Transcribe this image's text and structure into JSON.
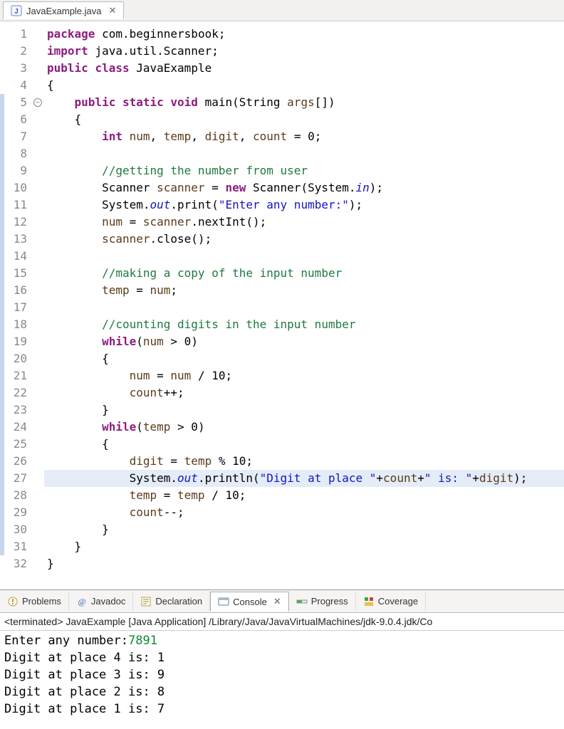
{
  "tab": {
    "filename": "JavaExample.java"
  },
  "gutter": {
    "lines": 32,
    "fold_at": 5
  },
  "highlight_line": 27,
  "blue_strip_ranges": [
    [
      5,
      31
    ]
  ],
  "code": {
    "l1": [
      [
        "kw",
        "package"
      ],
      [
        "punct",
        " "
      ],
      [
        "pkg",
        "com.beginnersbook"
      ],
      [
        "punct",
        ";"
      ]
    ],
    "l2": [
      [
        "kw",
        "import"
      ],
      [
        "punct",
        " "
      ],
      [
        "pkg",
        "java.util.Scanner"
      ],
      [
        "punct",
        ";"
      ]
    ],
    "l3": [
      [
        "kw",
        "public"
      ],
      [
        "punct",
        " "
      ],
      [
        "kw",
        "class"
      ],
      [
        "punct",
        " "
      ],
      [
        "cls",
        "JavaExample"
      ]
    ],
    "l4": [
      [
        "punct",
        "{"
      ]
    ],
    "l5": [
      [
        "punct",
        "    "
      ],
      [
        "kw",
        "public"
      ],
      [
        "punct",
        " "
      ],
      [
        "kw",
        "static"
      ],
      [
        "punct",
        " "
      ],
      [
        "kw",
        "void"
      ],
      [
        "punct",
        " "
      ],
      [
        "mname",
        "main"
      ],
      [
        "punct",
        "(String "
      ],
      [
        "var",
        "args"
      ],
      [
        "punct",
        "[])"
      ]
    ],
    "l6": [
      [
        "punct",
        "    {"
      ]
    ],
    "l7": [
      [
        "punct",
        "        "
      ],
      [
        "kw",
        "int"
      ],
      [
        "punct",
        " "
      ],
      [
        "var",
        "num"
      ],
      [
        "punct",
        ", "
      ],
      [
        "var",
        "temp"
      ],
      [
        "punct",
        ", "
      ],
      [
        "var",
        "digit"
      ],
      [
        "punct",
        ", "
      ],
      [
        "var",
        "count"
      ],
      [
        "punct",
        " = "
      ],
      [
        "num",
        "0"
      ],
      [
        "punct",
        ";"
      ]
    ],
    "l8": [
      [
        "punct",
        ""
      ]
    ],
    "l9": [
      [
        "punct",
        "        "
      ],
      [
        "cmt",
        "//getting the number from user"
      ]
    ],
    "l10": [
      [
        "punct",
        "        Scanner "
      ],
      [
        "var",
        "scanner"
      ],
      [
        "punct",
        " = "
      ],
      [
        "kw",
        "new"
      ],
      [
        "punct",
        " Scanner(System."
      ],
      [
        "stat",
        "in"
      ],
      [
        "punct",
        ");"
      ]
    ],
    "l11": [
      [
        "punct",
        "        System."
      ],
      [
        "stat",
        "out"
      ],
      [
        "punct",
        ".print("
      ],
      [
        "str",
        "\"Enter any number:\""
      ],
      [
        "punct",
        ");"
      ]
    ],
    "l12": [
      [
        "punct",
        "        "
      ],
      [
        "var",
        "num"
      ],
      [
        "punct",
        " = "
      ],
      [
        "var",
        "scanner"
      ],
      [
        "punct",
        ".nextInt();"
      ]
    ],
    "l13": [
      [
        "punct",
        "        "
      ],
      [
        "var",
        "scanner"
      ],
      [
        "punct",
        ".close();"
      ]
    ],
    "l14": [
      [
        "punct",
        ""
      ]
    ],
    "l15": [
      [
        "punct",
        "        "
      ],
      [
        "cmt",
        "//making a copy of the input number"
      ]
    ],
    "l16": [
      [
        "punct",
        "        "
      ],
      [
        "var",
        "temp"
      ],
      [
        "punct",
        " = "
      ],
      [
        "var",
        "num"
      ],
      [
        "punct",
        ";"
      ]
    ],
    "l17": [
      [
        "punct",
        ""
      ]
    ],
    "l18": [
      [
        "punct",
        "        "
      ],
      [
        "cmt",
        "//counting digits in the input number"
      ]
    ],
    "l19": [
      [
        "punct",
        "        "
      ],
      [
        "kw",
        "while"
      ],
      [
        "punct",
        "("
      ],
      [
        "var",
        "num"
      ],
      [
        "punct",
        " > 0)"
      ]
    ],
    "l20": [
      [
        "punct",
        "        {"
      ]
    ],
    "l21": [
      [
        "punct",
        "            "
      ],
      [
        "var",
        "num"
      ],
      [
        "punct",
        " = "
      ],
      [
        "var",
        "num"
      ],
      [
        "punct",
        " / 10;"
      ]
    ],
    "l22": [
      [
        "punct",
        "            "
      ],
      [
        "var",
        "count"
      ],
      [
        "punct",
        "++;"
      ]
    ],
    "l23": [
      [
        "punct",
        "        }"
      ]
    ],
    "l24": [
      [
        "punct",
        "        "
      ],
      [
        "kw",
        "while"
      ],
      [
        "punct",
        "("
      ],
      [
        "var",
        "temp"
      ],
      [
        "punct",
        " > 0)"
      ]
    ],
    "l25": [
      [
        "punct",
        "        {"
      ]
    ],
    "l26": [
      [
        "punct",
        "            "
      ],
      [
        "var",
        "digit"
      ],
      [
        "punct",
        " = "
      ],
      [
        "var",
        "temp"
      ],
      [
        "punct",
        " % 10;"
      ]
    ],
    "l27": [
      [
        "punct",
        "            System."
      ],
      [
        "stat",
        "out"
      ],
      [
        "punct",
        ".println("
      ],
      [
        "str",
        "\"Digit at place \""
      ],
      [
        "punct",
        "+"
      ],
      [
        "var",
        "count"
      ],
      [
        "punct",
        "+"
      ],
      [
        "str",
        "\" is: \""
      ],
      [
        "punct",
        "+"
      ],
      [
        "var",
        "digit"
      ],
      [
        "punct",
        ");"
      ]
    ],
    "l28": [
      [
        "punct",
        "            "
      ],
      [
        "var",
        "temp"
      ],
      [
        "punct",
        " = "
      ],
      [
        "var",
        "temp"
      ],
      [
        "punct",
        " / 10;"
      ]
    ],
    "l29": [
      [
        "punct",
        "            "
      ],
      [
        "var",
        "count"
      ],
      [
        "punct",
        "--;"
      ]
    ],
    "l30": [
      [
        "punct",
        "        }"
      ]
    ],
    "l31": [
      [
        "punct",
        "    }"
      ]
    ],
    "l32": [
      [
        "punct",
        "}"
      ]
    ]
  },
  "views": {
    "problems": "Problems",
    "javadoc": "Javadoc",
    "declaration": "Declaration",
    "console": "Console",
    "progress": "Progress",
    "coverage": "Coverage"
  },
  "console": {
    "status": "<terminated> JavaExample [Java Application] /Library/Java/JavaVirtualMachines/jdk-9.0.4.jdk/Co",
    "prompt": "Enter any number:",
    "input": "7891",
    "out1": "Digit at place 4 is: 1",
    "out2": "Digit at place 3 is: 9",
    "out3": "Digit at place 2 is: 8",
    "out4": "Digit at place 1 is: 7"
  }
}
